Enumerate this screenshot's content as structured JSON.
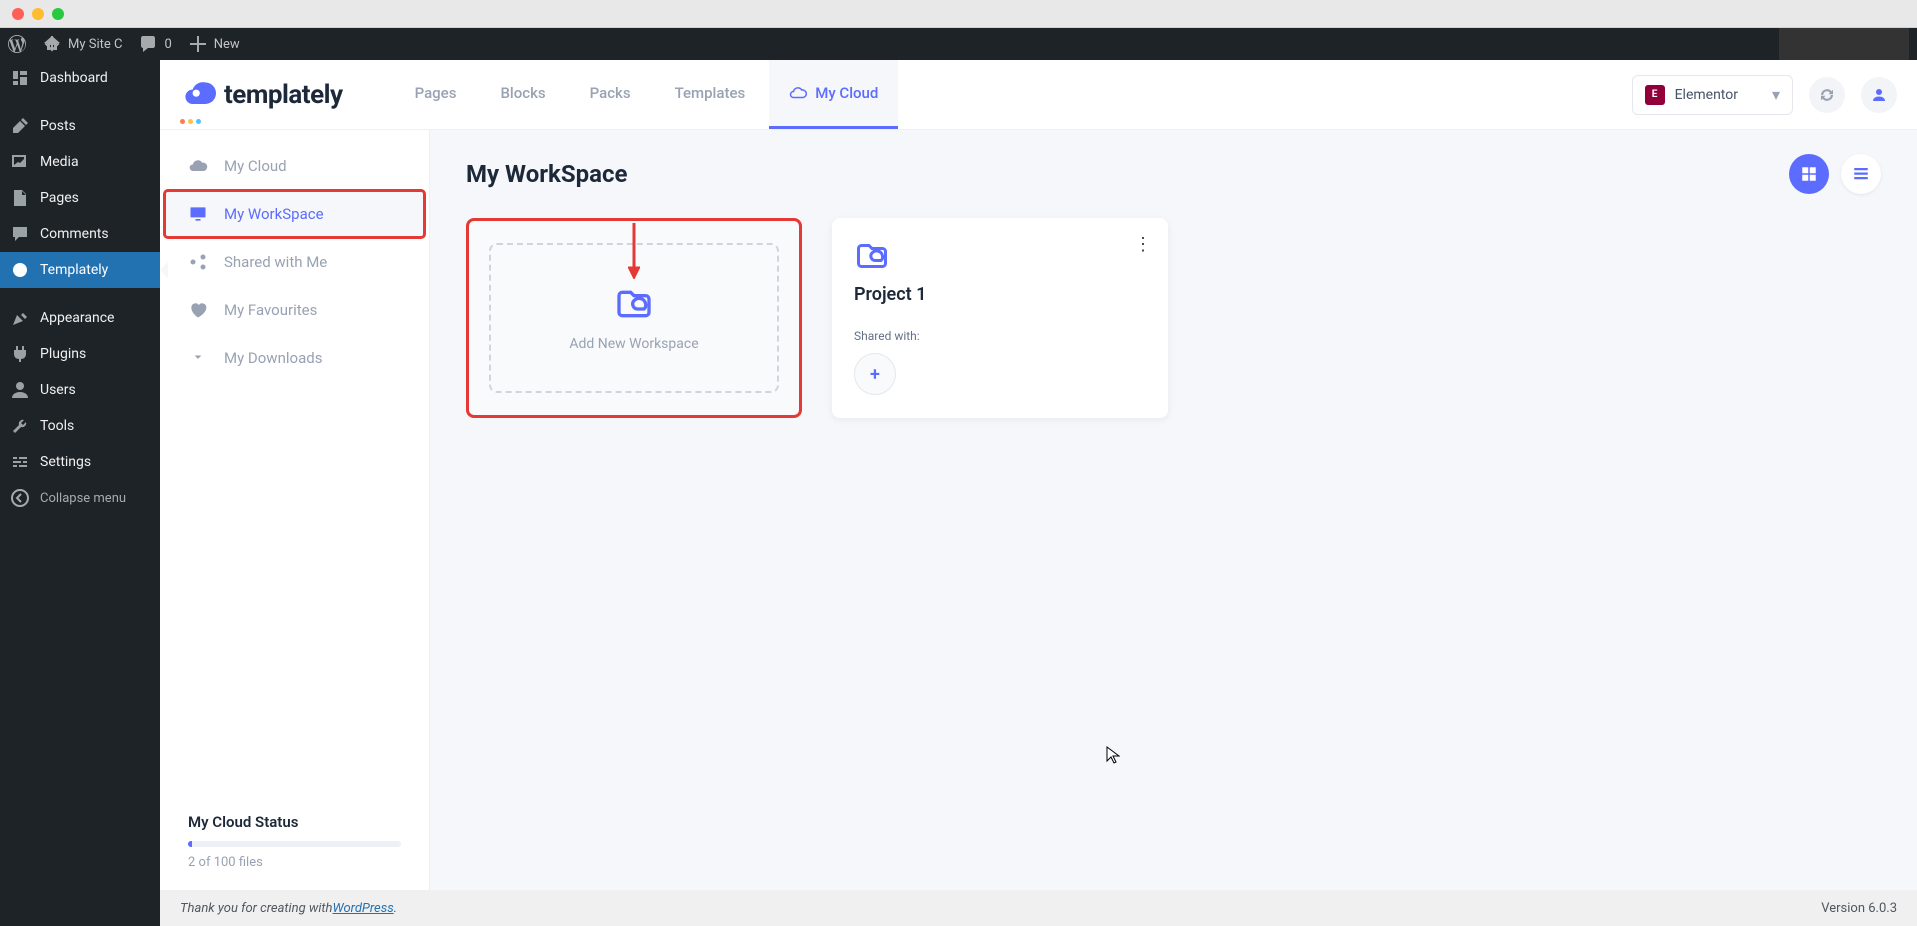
{
  "mac": {
    "title": ""
  },
  "adminbar": {
    "site_name": "My Site C",
    "comments": "0",
    "new_label": "New"
  },
  "wp_menu": [
    {
      "id": "dashboard",
      "label": "Dashboard",
      "icon": "dashboard"
    },
    {
      "id": "posts",
      "label": "Posts",
      "icon": "pin"
    },
    {
      "id": "media",
      "label": "Media",
      "icon": "media"
    },
    {
      "id": "pages",
      "label": "Pages",
      "icon": "page"
    },
    {
      "id": "comments",
      "label": "Comments",
      "icon": "comment"
    },
    {
      "id": "templately",
      "label": "Templately",
      "icon": "templately",
      "current": true
    },
    {
      "id": "appearance",
      "label": "Appearance",
      "icon": "brush"
    },
    {
      "id": "plugins",
      "label": "Plugins",
      "icon": "plugin"
    },
    {
      "id": "users",
      "label": "Users",
      "icon": "user"
    },
    {
      "id": "tools",
      "label": "Tools",
      "icon": "tools"
    },
    {
      "id": "settings",
      "label": "Settings",
      "icon": "settings"
    }
  ],
  "wp_collapse": "Collapse menu",
  "logo_text": "templately",
  "top_nav": [
    {
      "id": "pages",
      "label": "Pages"
    },
    {
      "id": "blocks",
      "label": "Blocks"
    },
    {
      "id": "packs",
      "label": "Packs"
    },
    {
      "id": "templates",
      "label": "Templates"
    },
    {
      "id": "mycloud",
      "label": "My Cloud",
      "active": true
    }
  ],
  "builder_select": {
    "label": "Elementor",
    "badge": "E"
  },
  "cloud_menu": [
    {
      "id": "mycloud",
      "label": "My Cloud"
    },
    {
      "id": "workspace",
      "label": "My WorkSpace",
      "active": true,
      "highlighted": true
    },
    {
      "id": "shared",
      "label": "Shared with Me"
    },
    {
      "id": "favourites",
      "label": "My Favourites"
    },
    {
      "id": "downloads",
      "label": "My Downloads"
    }
  ],
  "cloud_status": {
    "title": "My Cloud Status",
    "text": "2 of 100 files",
    "percent": 2
  },
  "page": {
    "title": "My WorkSpace",
    "add_label": "Add New Workspace",
    "project": {
      "title": "Project 1",
      "shared_label": "Shared with:"
    }
  },
  "footer": {
    "prefix": "Thank you for creating with ",
    "link": "WordPress",
    "suffix": ".",
    "version": "Version 6.0.3"
  }
}
